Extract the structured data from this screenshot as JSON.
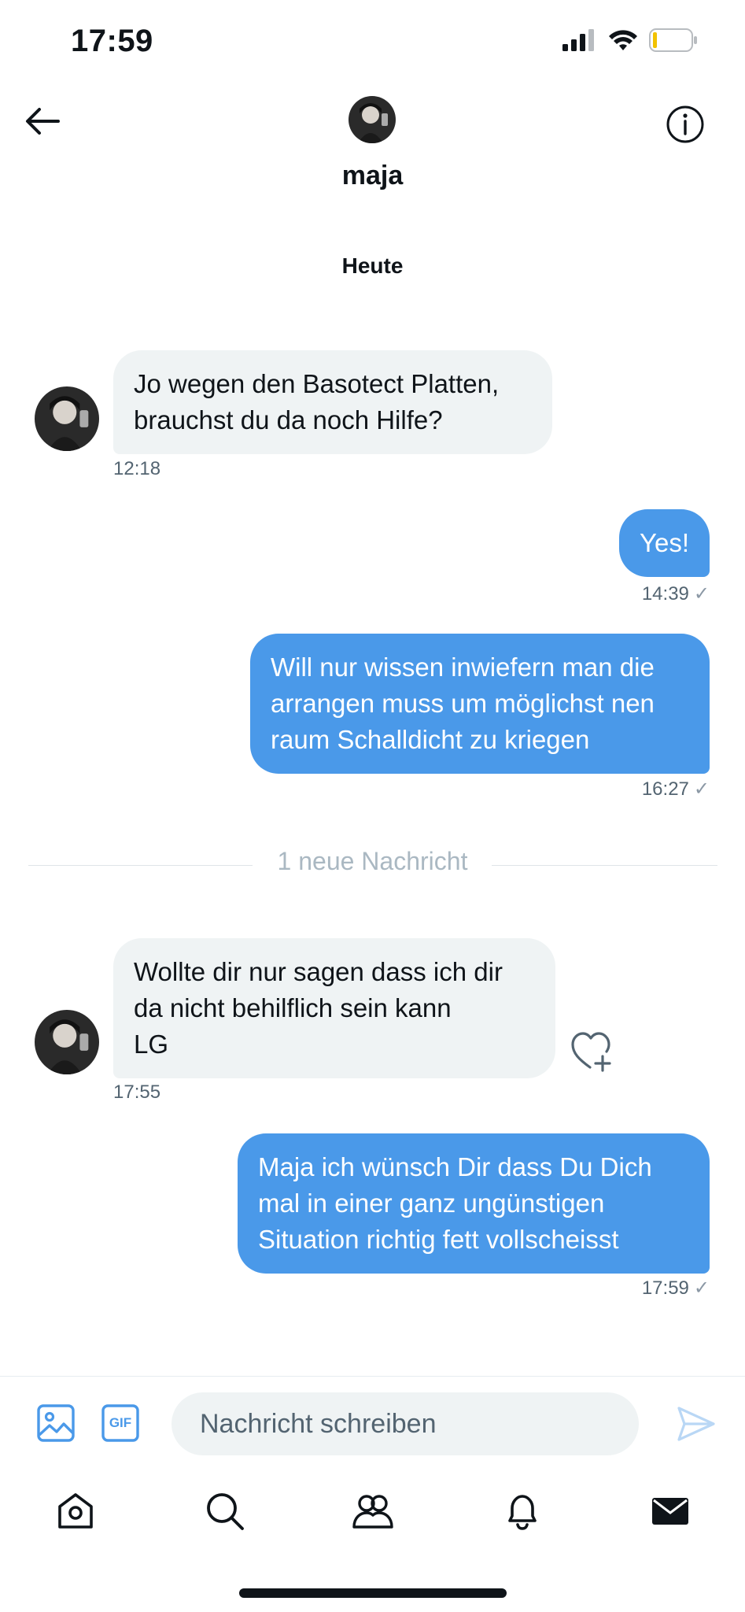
{
  "status_bar": {
    "time": "17:59"
  },
  "header": {
    "name": "maja"
  },
  "conversation": {
    "day_label": "Heute",
    "messages": [
      {
        "direction": "in",
        "lines": [
          "Jo wegen den Basotect Platten,",
          "brauchst du da noch Hilfe?"
        ],
        "time": "12:18"
      },
      {
        "direction": "out",
        "lines": [
          "Yes!"
        ],
        "time": "14:39",
        "check": "✓"
      },
      {
        "direction": "out",
        "lines": [
          "Will nur wissen inwiefern man die",
          "arrangen muss um möglichst nen",
          "raum Schalldicht zu kriegen"
        ],
        "time": "16:27",
        "check": "✓"
      },
      {
        "direction": "in",
        "lines": [
          "Wollte dir nur sagen dass ich dir",
          "da nicht behilflich sein kann",
          "LG"
        ],
        "time": "17:55"
      },
      {
        "direction": "out",
        "lines": [
          "Maja ich wünsch Dir dass Du Dich",
          "mal in einer ganz ungünstigen",
          "Situation richtig fett vollscheisst"
        ],
        "time": "17:59",
        "check": "✓"
      }
    ],
    "new_message_divider": "1 neue Nachricht"
  },
  "composer": {
    "placeholder": "Nachricht schreiben",
    "gif_label": "GIF"
  },
  "colors": {
    "accent": "#4a99e9",
    "incoming_bubble": "#eff3f4",
    "muted_text": "#536471"
  },
  "icons": {
    "header": [
      "back-arrow-icon",
      "info-icon"
    ],
    "composer": [
      "image-icon",
      "gif-icon",
      "send-icon"
    ],
    "tabs": [
      "home-icon",
      "search-icon",
      "communities-icon",
      "notifications-icon",
      "messages-icon"
    ]
  }
}
